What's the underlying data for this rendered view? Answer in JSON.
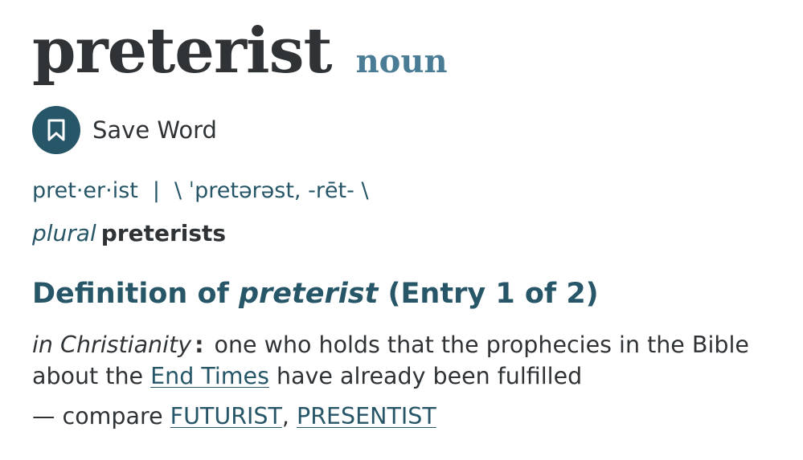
{
  "entry": {
    "headword": "preterist",
    "part_of_speech": "noun"
  },
  "save": {
    "icon": "bookmark-icon",
    "label": "Save Word"
  },
  "pronunciation": {
    "syllables": "pret·er·ist",
    "separator": "|",
    "ipa": "\\ ˈpretərəst, -rēt- \\"
  },
  "plural": {
    "label": "plural",
    "form": "preterists"
  },
  "definition": {
    "heading_prefix": "Definition of ",
    "heading_word": "preterist",
    "heading_suffix": " (Entry 1 of 2)",
    "subject_label": "in Christianity",
    "colon": ":",
    "text_before_link": " one who holds that the prophecies in the Bible about the ",
    "link_text": "End Times",
    "text_after_link": " have already been fulfilled"
  },
  "compare": {
    "prefix": "— compare ",
    "links": [
      "FUTURIST",
      "PRESENTIST"
    ],
    "separator": ", "
  },
  "colors": {
    "accent": "#265667",
    "pos": "#4a7d95",
    "text": "#303336"
  }
}
